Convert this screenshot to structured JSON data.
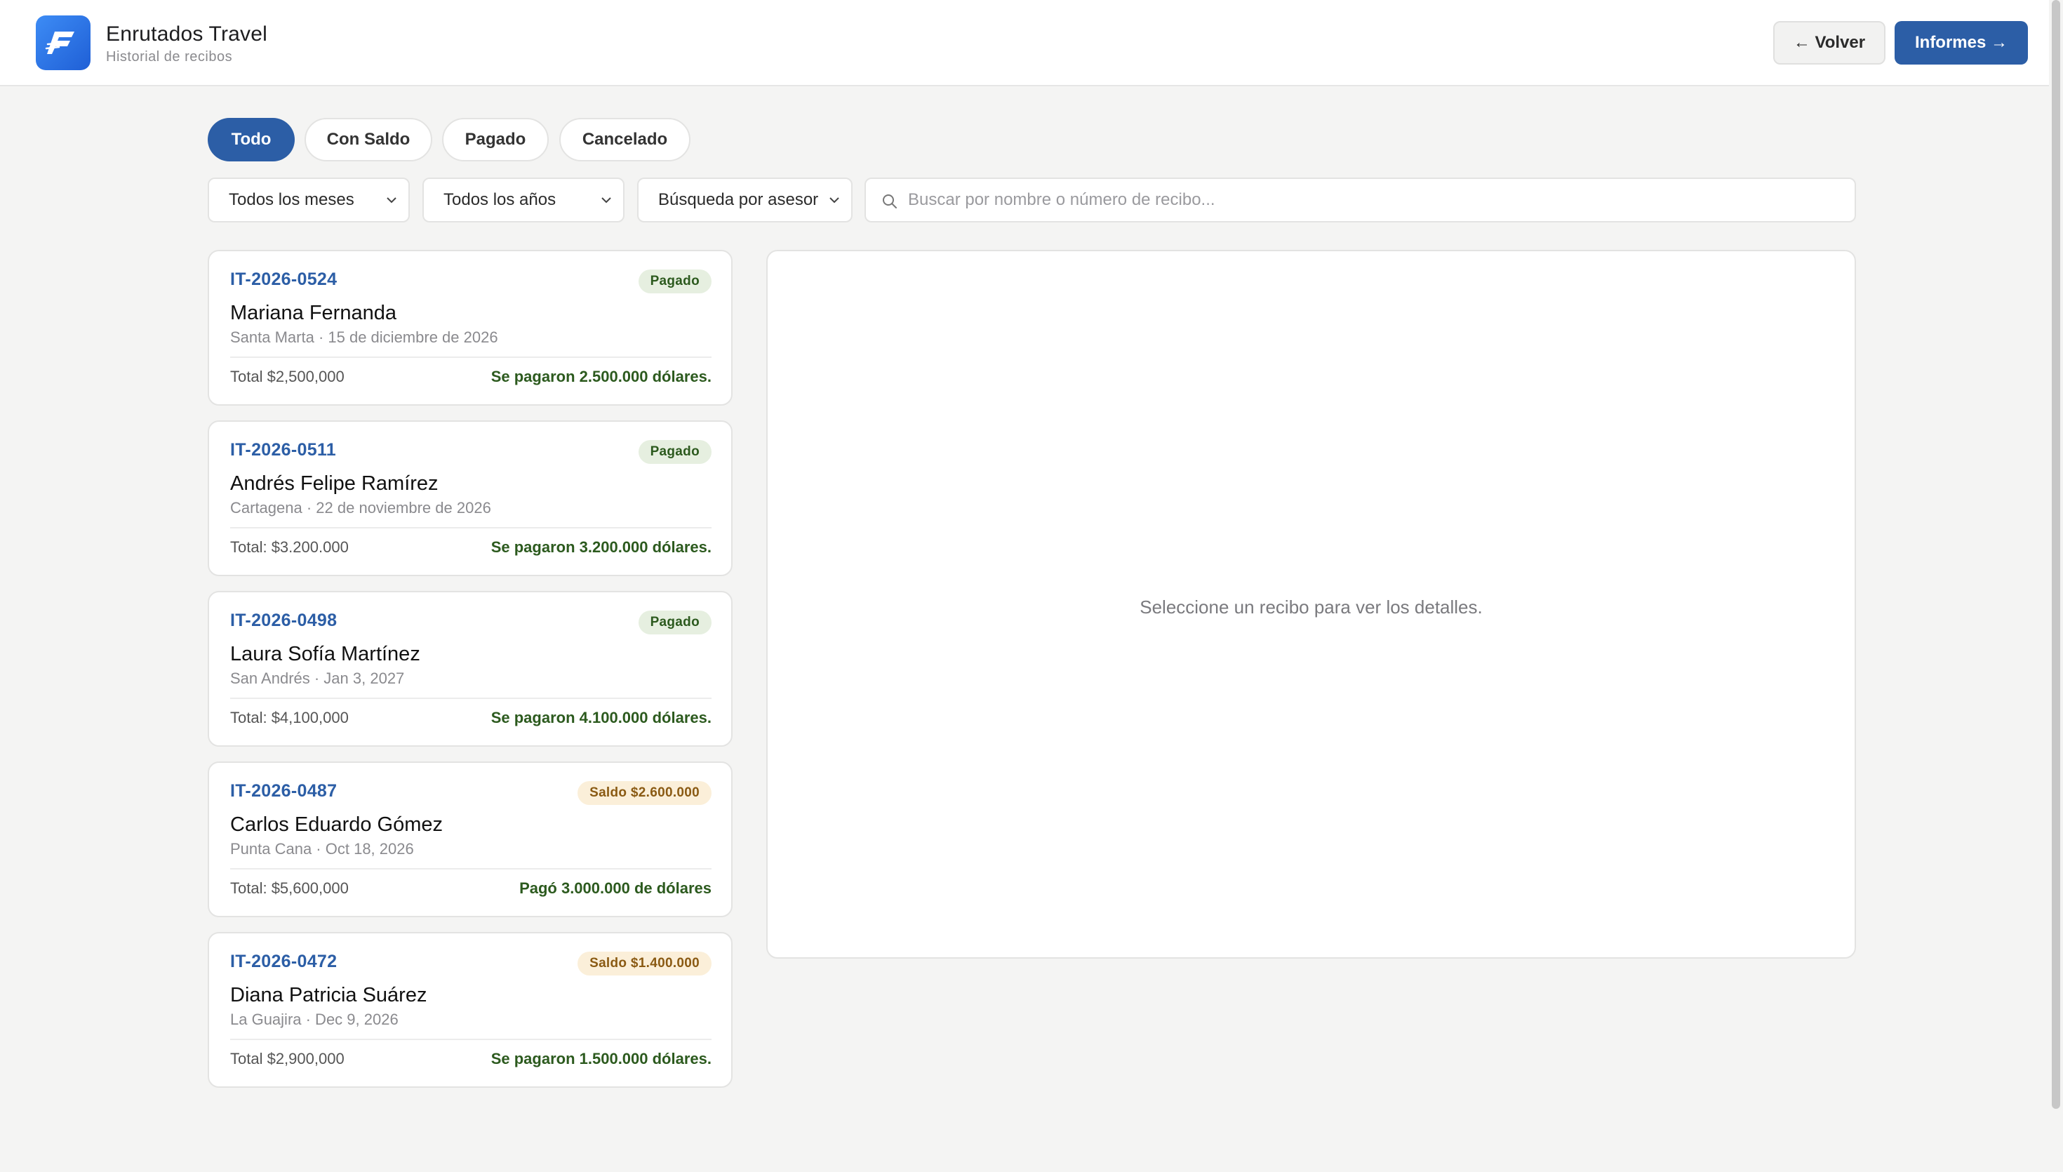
{
  "header": {
    "app_title": "Enrutados Travel",
    "app_subtitle": "Historial de recibos",
    "back_label": "← Volver",
    "reports_label": "Informes →",
    "logo_icon": "enrutados-logo-icon"
  },
  "tabs": [
    {
      "label": "Todo",
      "active": true
    },
    {
      "label": "Con Saldo",
      "active": false
    },
    {
      "label": "Pagado",
      "active": false
    },
    {
      "label": "Cancelado",
      "active": false
    }
  ],
  "filters": {
    "month": "Todos los meses",
    "year": "Todos los años",
    "advisor": "Búsqueda por asesor",
    "search_placeholder": "Buscar por nombre o número de recibo...",
    "search_value": ""
  },
  "receipts": [
    {
      "id": "IT-2026-0524",
      "badge": "Pagado",
      "status": "paid",
      "name": "Mariana Fernanda",
      "meta": "Santa Marta · 15 de diciembre de 2026",
      "total": "Total $2,500,000",
      "paid": "Se pagaron 2.500.000 dólares."
    },
    {
      "id": "IT-2026-0511",
      "badge": "Pagado",
      "status": "paid",
      "name": "Andrés Felipe Ramírez",
      "meta": "Cartagena · 22 de noviembre de 2026",
      "total": "Total: $3.200.000",
      "paid": "Se pagaron 3.200.000 dólares."
    },
    {
      "id": "IT-2026-0498",
      "badge": "Pagado",
      "status": "paid",
      "name": "Laura Sofía Martínez",
      "meta": "San Andrés · Jan 3, 2027",
      "total": "Total: $4,100,000",
      "paid": "Se pagaron 4.100.000 dólares."
    },
    {
      "id": "IT-2026-0487",
      "badge": "Saldo $2.600.000",
      "status": "balance",
      "name": "Carlos Eduardo Gómez",
      "meta": "Punta Cana · Oct 18, 2026",
      "total": "Total: $5,600,000",
      "paid": "Pagó 3.000.000 de dólares"
    },
    {
      "id": "IT-2026-0472",
      "badge": "Saldo $1.400.000",
      "status": "balance",
      "name": "Diana Patricia Suárez",
      "meta": "La Guajira · Dec 9, 2026",
      "total": "Total $2,900,000",
      "paid": "Se pagaron 1.500.000 dólares."
    }
  ],
  "detail": {
    "empty_message": "Seleccione un recibo para ver los detalles."
  },
  "colors": {
    "primary": "#2c5ea6",
    "paid_badge_bg": "#e6efe0",
    "paid_text": "#2c5a1e",
    "balance_badge_bg": "#fbefd9",
    "balance_text": "#8a5a13",
    "page_bg": "#f4f4f3"
  }
}
